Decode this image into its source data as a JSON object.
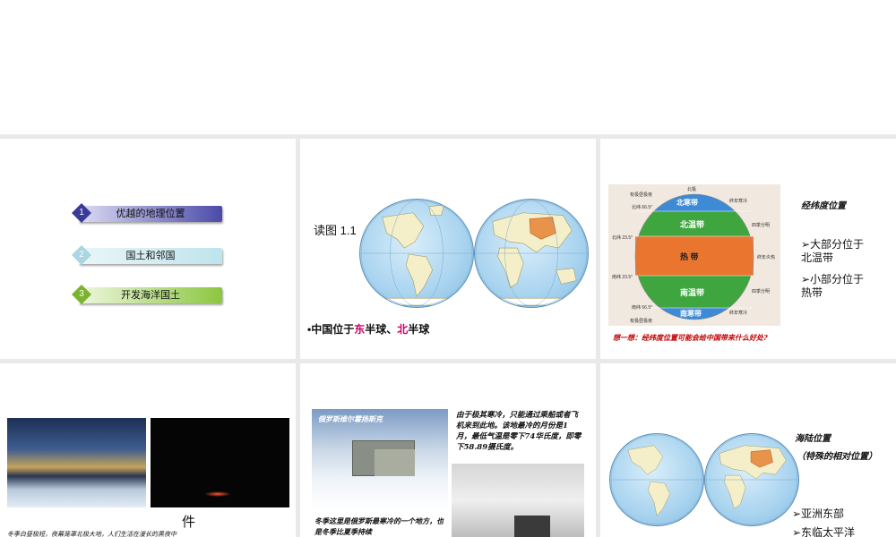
{
  "slide1": {
    "items": [
      {
        "num": "1",
        "label": "优越的地理位置",
        "color": "#4b4ba8"
      },
      {
        "num": "2",
        "label": "国土和邻国",
        "color": "#bfe4ec"
      },
      {
        "num": "3",
        "label": "开发海洋国土",
        "color": "#8cc63f"
      }
    ]
  },
  "slide2": {
    "read_label": "读图 1.1",
    "bullet_prefix": "•中国位于",
    "east": "东",
    "mid": "半球、",
    "north": "北",
    "suffix": "半球"
  },
  "slide3": {
    "heading": "经纬度位置",
    "point1_a": "➢大部分位于",
    "point1_b": "北温带",
    "point2_a": "➢小部分位于",
    "point2_b": "热带",
    "question": "想一想：经纬度位置可能会给中国带来什么好处?",
    "zones": {
      "north_frigid": "北寒带",
      "north_temperate": "北温带",
      "tropical": "热  带",
      "south_temperate": "南温带",
      "south_frigid": "南寒带"
    },
    "side_labels": {
      "north_pole": "北极",
      "arctic_circle": "北纬 66.5°",
      "tropic_cancer": "北纬 23.5°",
      "tropic_capricorn": "南纬 23.5°",
      "antarctic_circle": "南纬 66.5°",
      "polar_day_n": "有极昼极夜",
      "polar_day_s": "有极昼极夜",
      "no_heat_n": "终年寒冷",
      "four_seasons_n": "四季分明",
      "always_hot": "终年炎热",
      "four_seasons_s": "四季分明",
      "no_heat_s": "终年寒冷"
    }
  },
  "slide4": {
    "overlay_char": "件",
    "caption": "冬季白昼极短，夜幕笼罩北极大地，人们生活在漫长的黑夜中"
  },
  "slide5": {
    "photo_title": "俄罗斯维尔霍扬斯克",
    "para": "由于极其寒冷，只能通过乘船或者飞机来到此地。该地最冷的月份是1月，最低气温是零下74华氏度，即零下58.89摄氏度。",
    "bottom": "冬季这里是俄罗斯最寒冷的一个地方，也是冬季比夏季持续"
  },
  "slide6": {
    "heading": "海陆位置",
    "sub": "（特殊的相对位置）",
    "point1": "➢亚洲东部",
    "point2": "➢东临太平洋"
  },
  "colors": {
    "red_text": "#c00000",
    "magenta_text": "#cc0066",
    "menu1": "#4b4ba8",
    "menu2": "#bfe4ec",
    "menu3": "#8cc63f"
  }
}
